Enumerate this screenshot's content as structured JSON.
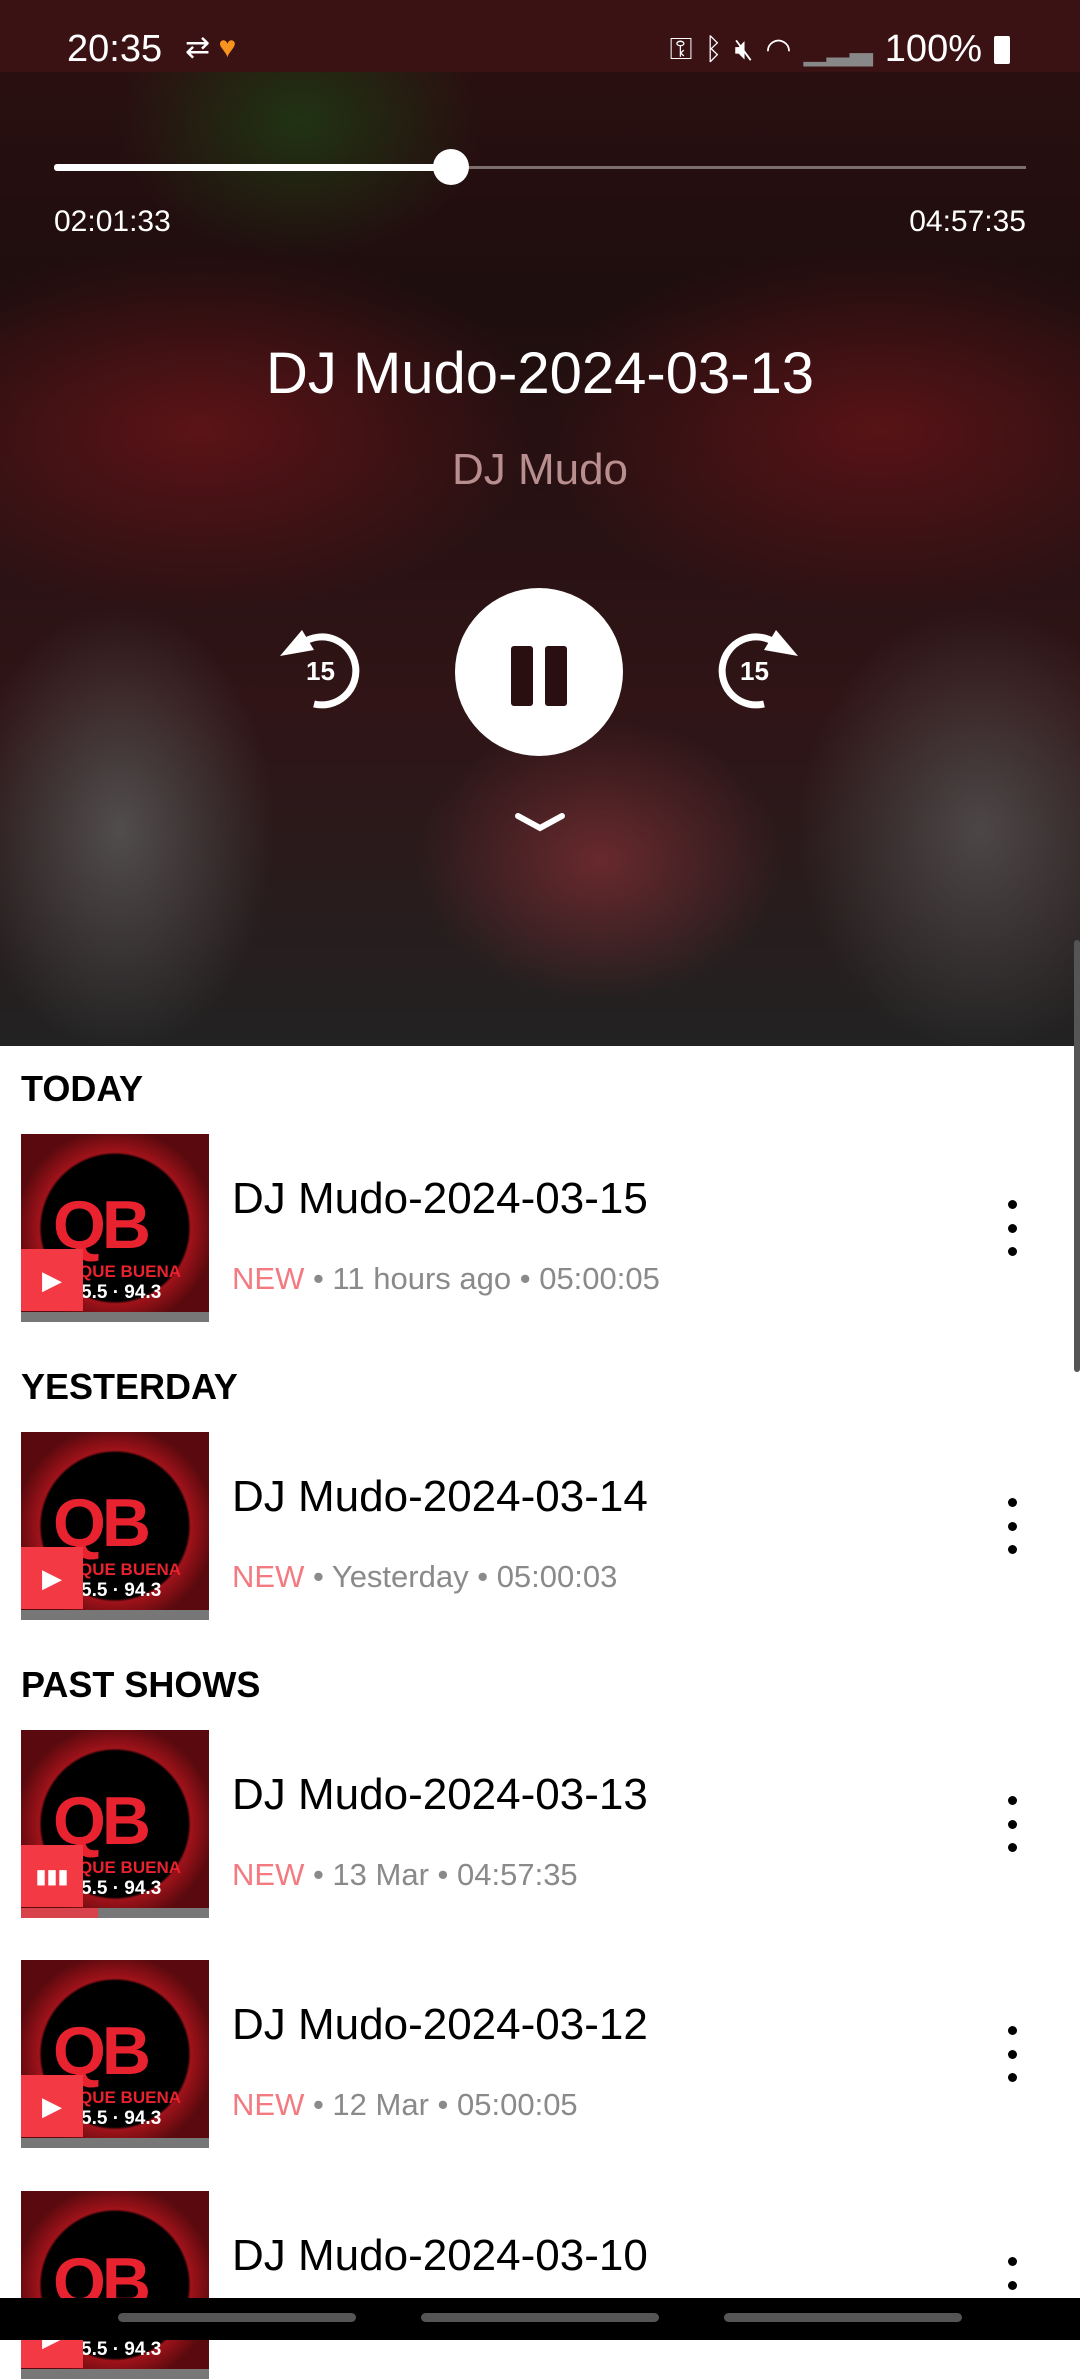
{
  "status_bar": {
    "time": "20:35",
    "battery": "100%",
    "icons": [
      "sync-icon",
      "heart-app-icon",
      "vpn-key-icon",
      "bluetooth-icon",
      "mute-icon",
      "wifi-icon",
      "signal-icon",
      "battery-icon"
    ]
  },
  "player": {
    "elapsed": "02:01:33",
    "duration": "04:57:35",
    "progress": 0.408,
    "title": "DJ Mudo-2024-03-13",
    "artist": "DJ Mudo",
    "rewind_seconds": "15",
    "forward_seconds": "15",
    "state": "playing"
  },
  "logo": {
    "text": "QB",
    "name": "QUE BUENA",
    "freq": "5.5 FM 94.3"
  },
  "colors": {
    "accent": "#f33a44",
    "new": "#f27a80"
  },
  "sections": [
    {
      "label": "TODAY",
      "items": [
        {
          "title": "DJ Mudo-2024-03-15",
          "badge": "NEW",
          "age": "11 hours ago",
          "duration": "05:00:05",
          "state": "play",
          "progress": 0
        }
      ]
    },
    {
      "label": "YESTERDAY",
      "items": [
        {
          "title": "DJ Mudo-2024-03-14",
          "badge": "NEW",
          "age": "Yesterday",
          "duration": "05:00:03",
          "state": "play",
          "progress": 0
        }
      ]
    },
    {
      "label": "PAST SHOWS",
      "items": [
        {
          "title": "DJ Mudo-2024-03-13",
          "badge": "NEW",
          "age": "13 Mar",
          "duration": "04:57:35",
          "state": "playing",
          "progress": 0.41
        },
        {
          "title": "DJ Mudo-2024-03-12",
          "badge": "NEW",
          "age": "12 Mar",
          "duration": "05:00:05",
          "state": "play",
          "progress": 0
        },
        {
          "title": "DJ Mudo-2024-03-10",
          "badge": "",
          "age": "",
          "duration": "",
          "state": "play",
          "progress": 0
        }
      ]
    }
  ]
}
